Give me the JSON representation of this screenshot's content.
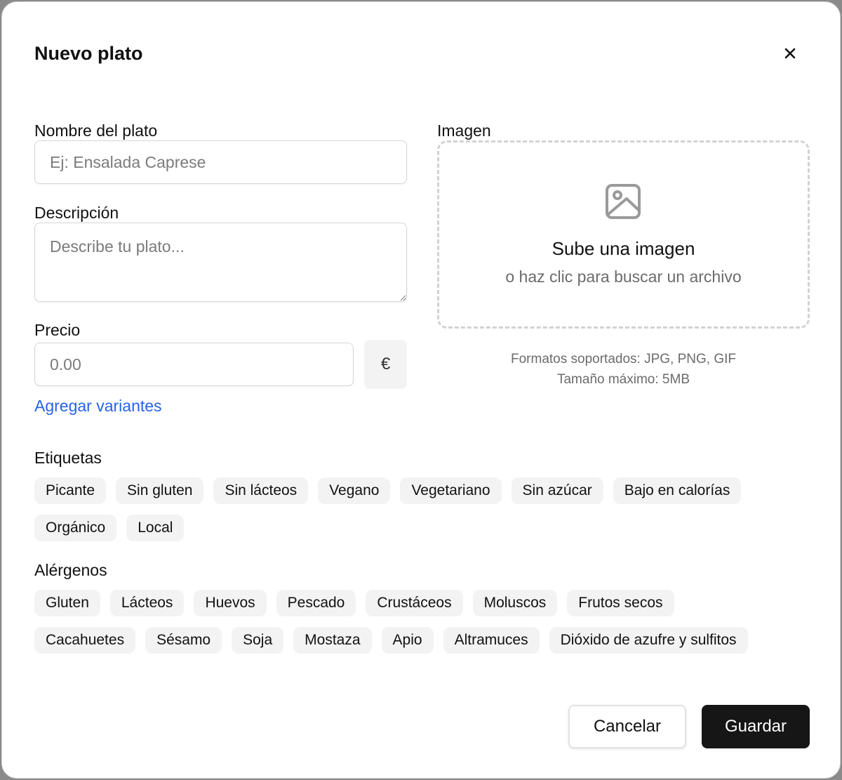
{
  "modal": {
    "title": "Nuevo plato"
  },
  "form": {
    "name_label": "Nombre del plato",
    "name_placeholder": "Ej: Ensalada Caprese",
    "description_label": "Descripción",
    "description_placeholder": "Describe tu plato...",
    "price_label": "Precio",
    "price_placeholder": "0.00",
    "currency_symbol": "€",
    "add_variants_link": "Agregar variantes"
  },
  "image": {
    "label": "Imagen",
    "upload_title": "Sube una imagen",
    "upload_subtitle": "o haz clic para buscar un archivo",
    "formats_text": "Formatos soportados: JPG, PNG, GIF",
    "max_size_text": "Tamaño máximo: 5MB",
    "icon": "image-icon"
  },
  "tags": {
    "title": "Etiquetas",
    "rows": [
      [
        "Picante",
        "Sin gluten",
        "Sin lácteos",
        "Vegano",
        "Vegetariano",
        "Sin azúcar",
        "Bajo en calorías"
      ],
      [
        "Orgánico",
        "Local"
      ]
    ]
  },
  "allergens": {
    "title": "Alérgenos",
    "rows": [
      [
        "Gluten",
        "Lácteos",
        "Huevos",
        "Pescado",
        "Crustáceos",
        "Moluscos",
        "Frutos secos"
      ],
      [
        "Cacahuetes",
        "Sésamo",
        "Soja",
        "Mostaza",
        "Apio",
        "Altramuces",
        "Dióxido de azufre y sulfitos"
      ]
    ]
  },
  "actions": {
    "cancel_label": "Cancelar",
    "save_label": "Guardar"
  },
  "colors": {
    "link": "#2563eb",
    "primary_button": "#161616",
    "chip_background": "#f3f3f3"
  }
}
